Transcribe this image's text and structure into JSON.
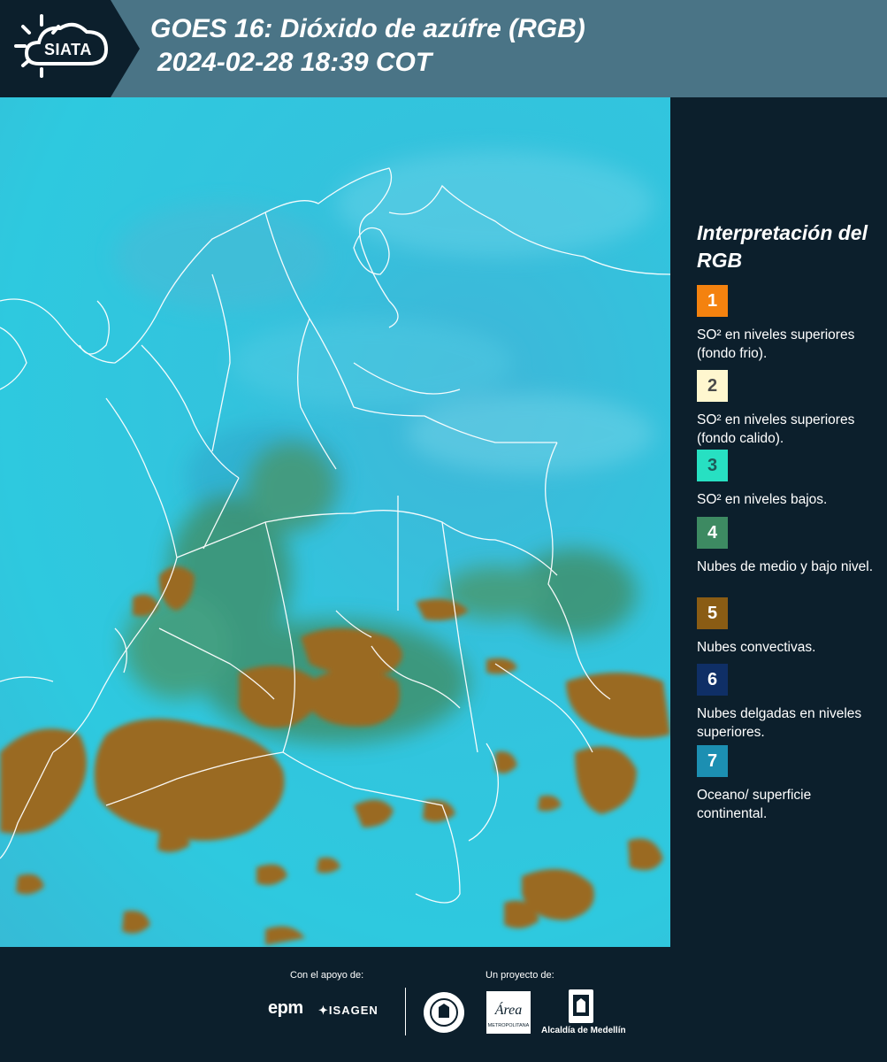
{
  "header": {
    "logo_text": "SIATA",
    "title": "GOES 16: Dióxido de azúfre (RGB)",
    "subtitle": "2024-02-28 18:39 COT",
    "background_color": "#4a7486",
    "logo_box_color": "#0c1f2c"
  },
  "legend": {
    "title": "Interpretación del RGB",
    "items": [
      {
        "number": "1",
        "label": "SO² en niveles superiores (fondo frio).",
        "color": "#f4820f",
        "text_color": "#ffffff"
      },
      {
        "number": "2",
        "label": "SO² en niveles superiores (fondo calido).",
        "color": "#fff7cf",
        "text_color": "#4a4a4a"
      },
      {
        "number": "3",
        "label": "SO² en niveles bajos.",
        "color": "#27e0c2",
        "text_color": "#1e5a5a"
      },
      {
        "number": "4",
        "label": "Nubes de medio y bajo nivel.",
        "color": "#3d8a62",
        "text_color": "#ffffff"
      },
      {
        "number": "5",
        "label": "Nubes convectivas.",
        "color": "#8a5c14",
        "text_color": "#ffffff"
      },
      {
        "number": "6",
        "label": "Nubes delgadas en niveles superiores.",
        "color": "#0f2f66",
        "text_color": "#ffffff"
      },
      {
        "number": "7",
        "label": "Oceano/ superficie continental.",
        "color": "#1c8fb2",
        "text_color": "#ffffff"
      }
    ]
  },
  "footer": {
    "support_label": "Con el apoyo de:",
    "project_label": "Un proyecto de:",
    "epm": "epm",
    "isagen": "ISAGEN",
    "alcaldia": "Alcaldía de Medellín",
    "area_text": "Área",
    "area_sub": "METROPOLITANA"
  },
  "colors": {
    "map_water": "#2ec9df",
    "cloud_convective": "#9a6a22",
    "cloud_low": "#3f8a5e",
    "border_line": "#ffffff"
  }
}
